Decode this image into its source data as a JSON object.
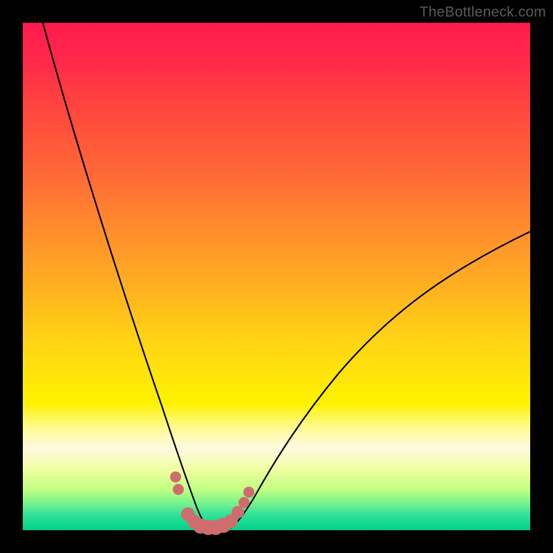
{
  "watermark": "TheBottleneck.com",
  "chart_data": {
    "type": "line",
    "title": "",
    "xlabel": "",
    "ylabel": "",
    "xlim": [
      0,
      100
    ],
    "ylim": [
      0,
      100
    ],
    "grid": false,
    "legend": false,
    "series": [
      {
        "name": "left-curve",
        "x": [
          4,
          8,
          12,
          16,
          20,
          24,
          28,
          30,
          32,
          33,
          34,
          35
        ],
        "y": [
          100,
          88,
          74,
          60,
          46,
          32,
          18,
          11,
          5,
          3,
          1.5,
          0.5
        ],
        "color": "#000000"
      },
      {
        "name": "right-curve",
        "x": [
          41,
          43,
          46,
          50,
          55,
          60,
          66,
          72,
          78,
          85,
          92,
          100
        ],
        "y": [
          0.5,
          2,
          6,
          12,
          20,
          27,
          34,
          40,
          45,
          50,
          55,
          59
        ],
        "color": "#000000"
      },
      {
        "name": "bottom-markers",
        "type": "scatter",
        "x": [
          30.0,
          30.6,
          32.5,
          33.8,
          35.0,
          36.5,
          38.0,
          39.5,
          41.0,
          42.4,
          43.6,
          44.6
        ],
        "y": [
          10.5,
          8.0,
          3.2,
          1.6,
          0.9,
          0.6,
          0.6,
          0.9,
          1.8,
          3.6,
          5.4,
          7.6
        ],
        "r": [
          8,
          8,
          10,
          10,
          11,
          11,
          11,
          11,
          10,
          9,
          8,
          8
        ],
        "color": "#cf6d6d"
      }
    ],
    "gradient_stops": [
      {
        "pos": 0.0,
        "color": "#ff1a4d"
      },
      {
        "pos": 0.3,
        "color": "#ff6a36"
      },
      {
        "pos": 0.62,
        "color": "#ffd215"
      },
      {
        "pos": 0.8,
        "color": "#fff97a"
      },
      {
        "pos": 1.0,
        "color": "#00d087"
      }
    ]
  }
}
